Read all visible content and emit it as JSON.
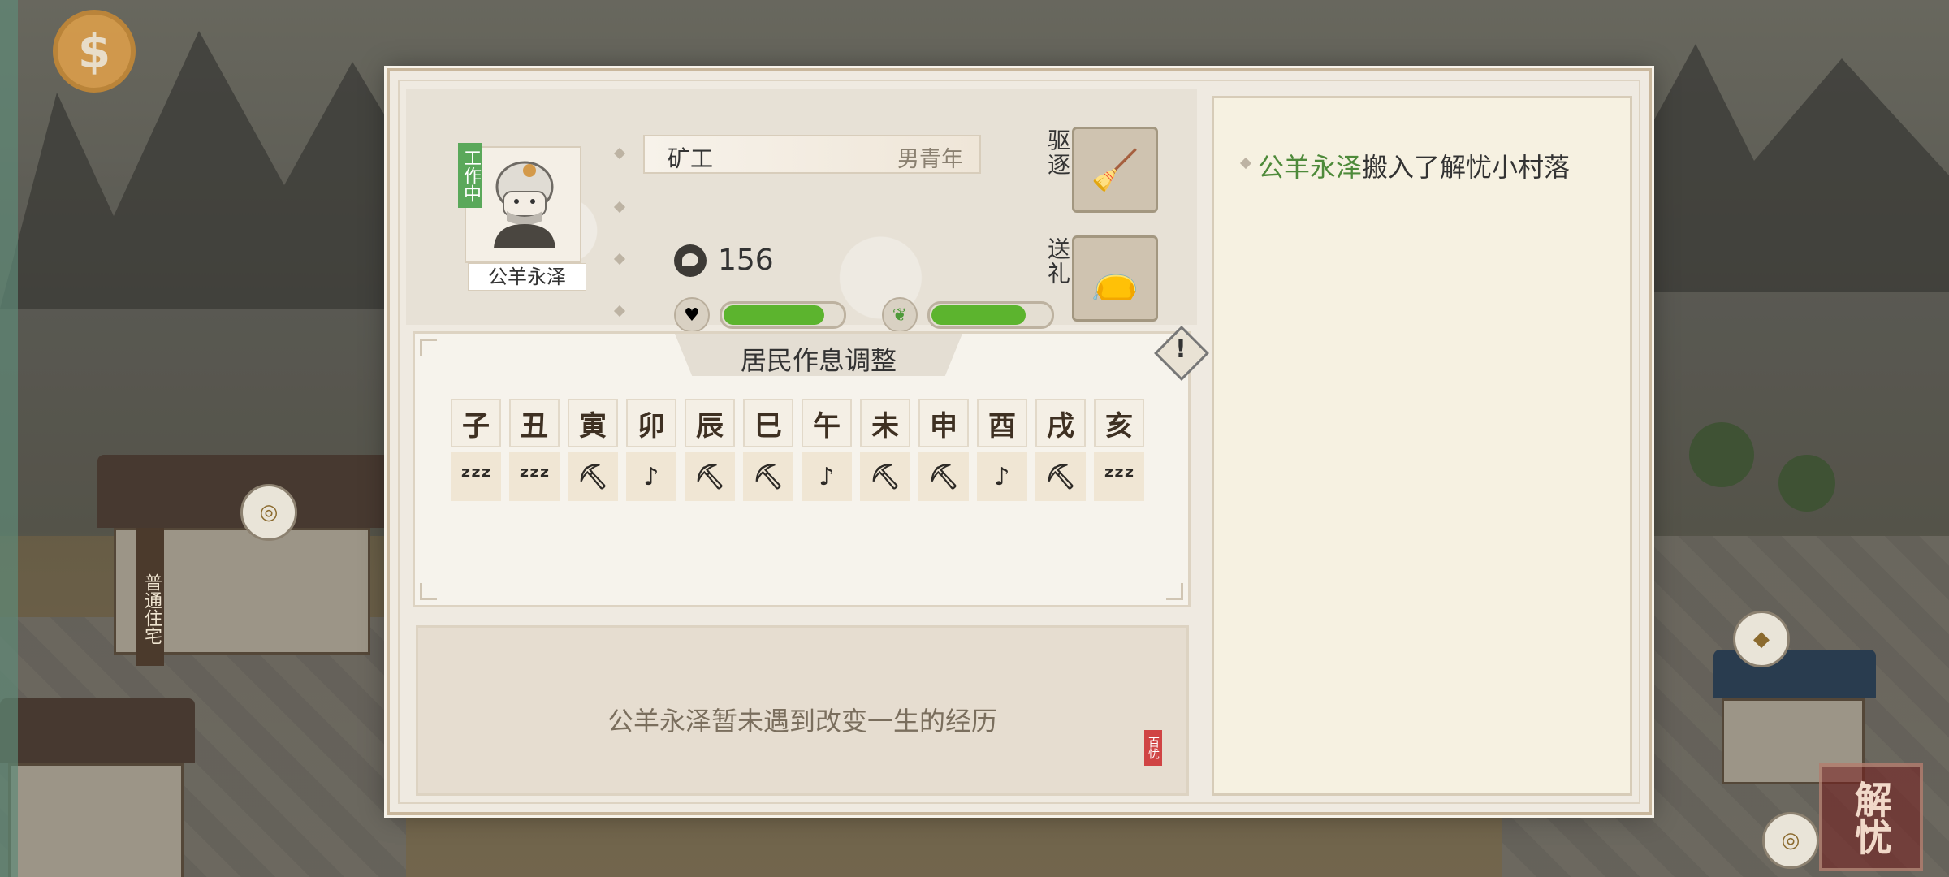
{
  "background": {
    "side_sign": "普通住宅",
    "logo": "解忧"
  },
  "resident": {
    "name": "公羊永泽",
    "status_badge": "工作中",
    "job": "矿工",
    "profile": "男青年",
    "value": "156",
    "bar1_level": 0.85,
    "bar2_level": 0.8
  },
  "actions": {
    "expel_label": "驱逐",
    "gift_label": "送礼"
  },
  "schedule": {
    "title": "居民作息调整",
    "hours": [
      "子",
      "丑",
      "寅",
      "卯",
      "辰",
      "巳",
      "午",
      "未",
      "申",
      "酉",
      "戌",
      "亥"
    ],
    "activities": [
      "sleep",
      "sleep",
      "work",
      "leisure",
      "work",
      "work",
      "leisure",
      "work",
      "work",
      "leisure",
      "work",
      "sleep"
    ]
  },
  "experience": {
    "text": "公羊永泽暂未遇到改变一生的经历",
    "seal": "百忧"
  },
  "log": {
    "entry_name": "公羊永泽",
    "entry_text": "搬入了解忧小村落"
  },
  "icons": {
    "sleep": "ᶻᶻᶻ",
    "work": "⛏",
    "leisure": "♪"
  }
}
